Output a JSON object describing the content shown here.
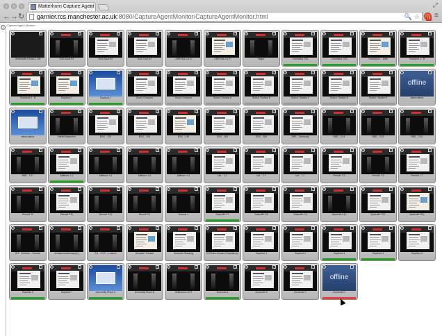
{
  "browser": {
    "tab_title": "Matterhorn Capture Agent",
    "url_host": "garnier.rcs.manchester.ac.uk",
    "url_path": ":8080/CaptureAgentMonitor/CaptureAgentMonitor.html",
    "badge": "16"
  },
  "icons": {
    "back": "←",
    "forward": "→",
    "reload": "↻",
    "search": "🔍",
    "star": "☆",
    "menu": "≡",
    "close": "×",
    "resize": "⤢"
  },
  "page": {
    "top_label": "Capture Agent Monitor"
  },
  "colors": {
    "recording": "#28a028",
    "idle_status": "#9a9a9a",
    "error": "#e04040",
    "offline_screen": "#3a5a90"
  },
  "agents": [
    {
      "name": "Greenwich House 1 LW",
      "thumb": "blank",
      "status": ""
    },
    {
      "name": "GBS Dual R1",
      "thumb": "camera",
      "status": ""
    },
    {
      "name": "GBS Dual R2",
      "thumb": "slide",
      "status": ""
    },
    {
      "name": "GBS Hub G1",
      "thumb": "slide",
      "status": ""
    },
    {
      "name": "GBS Hub G1-4",
      "thumb": "camera",
      "status": ""
    },
    {
      "name": "GBS Hub G1-F",
      "thumb": "colorful",
      "status": ""
    },
    {
      "name": "Major",
      "thumb": "camera",
      "status": ""
    },
    {
      "name": "Chemistry G51",
      "thumb": "slide",
      "status": "recording"
    },
    {
      "name": "Chemistry G53",
      "thumb": "slide",
      "status": "recording"
    },
    {
      "name": "Crawford 1 - Wall",
      "thumb": "colorful",
      "status": "recording"
    },
    {
      "name": "Crawford 1 - B",
      "thumb": "slide",
      "status": "recording"
    },
    {
      "name": "Crawford 2 - B",
      "thumb": "colorful",
      "status": "recording"
    },
    {
      "name": "Stopford 1",
      "thumb": "colorful",
      "status": "recording"
    },
    {
      "name": "Stopford 2",
      "thumb": "blue",
      "status": "recording"
    },
    {
      "name": "Dover Crescent",
      "thumb": "slide",
      "status": "idle"
    },
    {
      "name": "Dover Crescent",
      "thumb": "slide",
      "status": "idle"
    },
    {
      "name": "Simon Theatre A",
      "thumb": "slide",
      "status": "idle"
    },
    {
      "name": "Simon Theatre B",
      "thumb": "slide",
      "status": "idle"
    },
    {
      "name": "Simon Theatre C",
      "thumb": "slide",
      "status": "idle"
    },
    {
      "name": "Simon Theatre D",
      "thumb": "slide",
      "status": "idle"
    },
    {
      "name": "Simon Theatre E",
      "thumb": "slide",
      "status": "idle"
    },
    {
      "name": "demo-demo",
      "thumb": "offline",
      "status": "",
      "offline_text": "offline"
    },
    {
      "name": "demo-demo",
      "thumb": "blue",
      "status": ""
    },
    {
      "name": "Hartel Basement",
      "thumb": "camera",
      "status": ""
    },
    {
      "name": "ENG - 200",
      "thumb": "slide",
      "status": ""
    },
    {
      "name": "ENG - 300",
      "thumb": "slide",
      "status": ""
    },
    {
      "name": "ENG - 340",
      "thumb": "colorful",
      "status": ""
    },
    {
      "name": "ENG - 460",
      "thumb": "slide",
      "status": ""
    },
    {
      "name": "ENG - 480",
      "thumb": "slide",
      "status": ""
    },
    {
      "name": "BBB - Samsung",
      "thumb": "slide",
      "status": ""
    },
    {
      "name": "BBB - G14",
      "thumb": "camera",
      "status": ""
    },
    {
      "name": "BBB - G15",
      "thumb": "camera",
      "status": ""
    },
    {
      "name": "BBB - G16",
      "thumb": "camera",
      "status": ""
    },
    {
      "name": "BBB - G17",
      "thumb": "camera",
      "status": ""
    },
    {
      "name": "Millburn 1.1",
      "thumb": "slide",
      "status": "recording"
    },
    {
      "name": "Millburn 1.5",
      "thumb": "camera",
      "status": ""
    },
    {
      "name": "Millburn 1.6",
      "thumb": "camera",
      "status": ""
    },
    {
      "name": "Millburn 1.4",
      "thumb": "camera",
      "status": ""
    },
    {
      "name": "MX - 2.1",
      "thumb": "slide",
      "status": ""
    },
    {
      "name": "MX - 2.2",
      "thumb": "slide",
      "status": ""
    },
    {
      "name": "MX - 3.1",
      "thumb": "slide",
      "status": ""
    },
    {
      "name": "Renold 1.5",
      "thumb": "slide",
      "status": ""
    },
    {
      "name": "Renold 1.6",
      "thumb": "camera",
      "status": ""
    },
    {
      "name": "Renold 1.7",
      "thumb": "slide",
      "status": ""
    },
    {
      "name": "Renold 10",
      "thumb": "camera",
      "status": ""
    },
    {
      "name": "Renold F11",
      "thumb": "slide",
      "status": ""
    },
    {
      "name": "Renold G11",
      "thumb": "camera",
      "status": ""
    },
    {
      "name": "Renold C2",
      "thumb": "camera",
      "status": ""
    },
    {
      "name": "Roscoe 1",
      "thumb": "camera",
      "status": ""
    },
    {
      "name": "Sackville C7",
      "thumb": "slide",
      "status": "recording"
    },
    {
      "name": "Sackville C8",
      "thumb": "slide",
      "status": ""
    },
    {
      "name": "Sackville C9",
      "thumb": "slide",
      "status": ""
    },
    {
      "name": "Sackville F47",
      "thumb": "camera",
      "status": ""
    },
    {
      "name": "Sackville G37",
      "thumb": "slide",
      "status": ""
    },
    {
      "name": "Sackville G11",
      "thumb": "colorful",
      "status": ""
    },
    {
      "name": "EH - Chinese - Theatre",
      "thumb": "camera",
      "status": ""
    },
    {
      "name": "armaturewaterway1(L)",
      "thumb": "camera",
      "status": ""
    },
    {
      "name": "EH - 1.0 C - Lecture",
      "thumb": "camera",
      "status": ""
    },
    {
      "name": "Schuster Theatre",
      "thumb": "colorful",
      "status": ""
    },
    {
      "name": "Schuster Reading",
      "thumb": "slide",
      "status": ""
    },
    {
      "name": "St Peters House (Chaplaincy)",
      "thumb": "slide",
      "status": ""
    },
    {
      "name": "Stopford 1",
      "thumb": "slide",
      "status": ""
    },
    {
      "name": "Stopford 2",
      "thumb": "slide",
      "status": ""
    },
    {
      "name": "Stopford 3",
      "thumb": "slide",
      "status": "recording"
    },
    {
      "name": "Stopford 4",
      "thumb": "slide",
      "status": "recording"
    },
    {
      "name": "Stopford 5",
      "thumb": "slide",
      "status": ""
    },
    {
      "name": "Stopford 6",
      "thumb": "slide",
      "status": "recording"
    },
    {
      "name": "Stopford 7",
      "thumb": "slide",
      "status": ""
    },
    {
      "name": "University Place A",
      "thumb": "blue",
      "status": "recording"
    },
    {
      "name": "University Place B",
      "thumb": "camera",
      "status": ""
    },
    {
      "name": "Williamson G27",
      "thumb": "camera",
      "status": ""
    },
    {
      "name": "Zochonis A",
      "thumb": "camera",
      "status": "recording"
    },
    {
      "name": "Zochonis B",
      "thumb": "slide",
      "status": ""
    },
    {
      "name": "Zochonis C",
      "thumb": "slide",
      "status": ""
    },
    {
      "name": "Zochonis D",
      "thumb": "offline",
      "status": "error",
      "offline_text": "offline"
    }
  ]
}
